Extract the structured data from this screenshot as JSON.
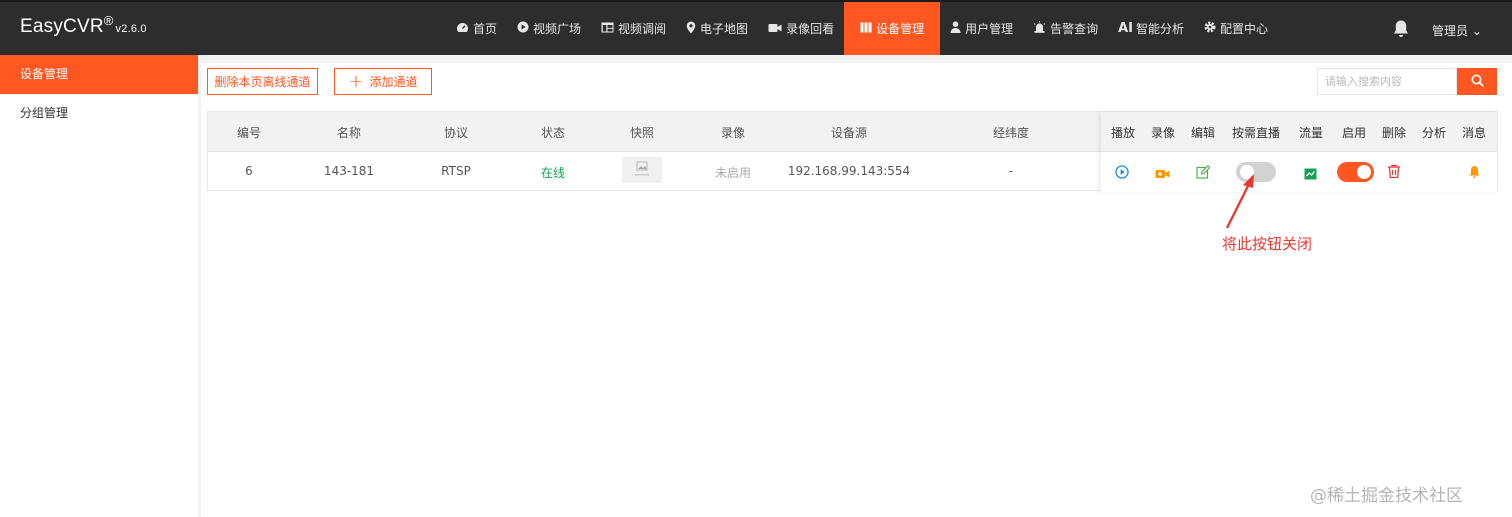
{
  "brand": {
    "name": "EasyCVR",
    "reg": "®",
    "version": "v2.6.0"
  },
  "nav": [
    {
      "label": "首页",
      "icon": "dashboard-icon"
    },
    {
      "label": "视频广场",
      "icon": "play-circle-icon"
    },
    {
      "label": "视频调阅",
      "icon": "layout-icon"
    },
    {
      "label": "电子地图",
      "icon": "map-pin-icon"
    },
    {
      "label": "录像回看",
      "icon": "video-camera-icon"
    },
    {
      "label": "设备管理",
      "icon": "device-icon",
      "active": true
    },
    {
      "label": "用户管理",
      "icon": "user-icon"
    },
    {
      "label": "告警查询",
      "icon": "alarm-icon"
    },
    {
      "label": "智能分析",
      "icon": "ai-icon",
      "prefix": "AI"
    },
    {
      "label": "配置中心",
      "icon": "gear-icon"
    }
  ],
  "user": {
    "label": "管理员 ⌄"
  },
  "sidebar": {
    "items": [
      {
        "label": "设备管理",
        "active": true
      },
      {
        "label": "分组管理"
      }
    ]
  },
  "toolbar": {
    "delete_offline_label": "删除本页离线通道",
    "add_channel_label": "添加通道",
    "search_placeholder": "请输入搜索内容"
  },
  "table": {
    "columns": [
      "编号",
      "名称",
      "协议",
      "状态",
      "快照",
      "录像",
      "设备源",
      "经纬度"
    ],
    "action_columns": [
      "播放",
      "录像",
      "编辑",
      "按需直播",
      "流量",
      "启用",
      "删除",
      "分析",
      "消息"
    ],
    "rows": [
      {
        "id": "6",
        "name": "143-181",
        "protocol": "RTSP",
        "status": "在线",
        "snapshot": "",
        "record": "未启用",
        "source": "192.168.99.143:554",
        "latlng": "-",
        "on_demand": false,
        "enabled": true
      }
    ]
  },
  "annotation": {
    "text": "将此按钮关闭"
  },
  "watermark": {
    "text": "@稀土掘金技术社区"
  },
  "colors": {
    "accent": "#ff5722",
    "topbar": "#2d2d2d",
    "online": "#18a058",
    "play": "#1e88e5",
    "annot": "#e53935"
  }
}
